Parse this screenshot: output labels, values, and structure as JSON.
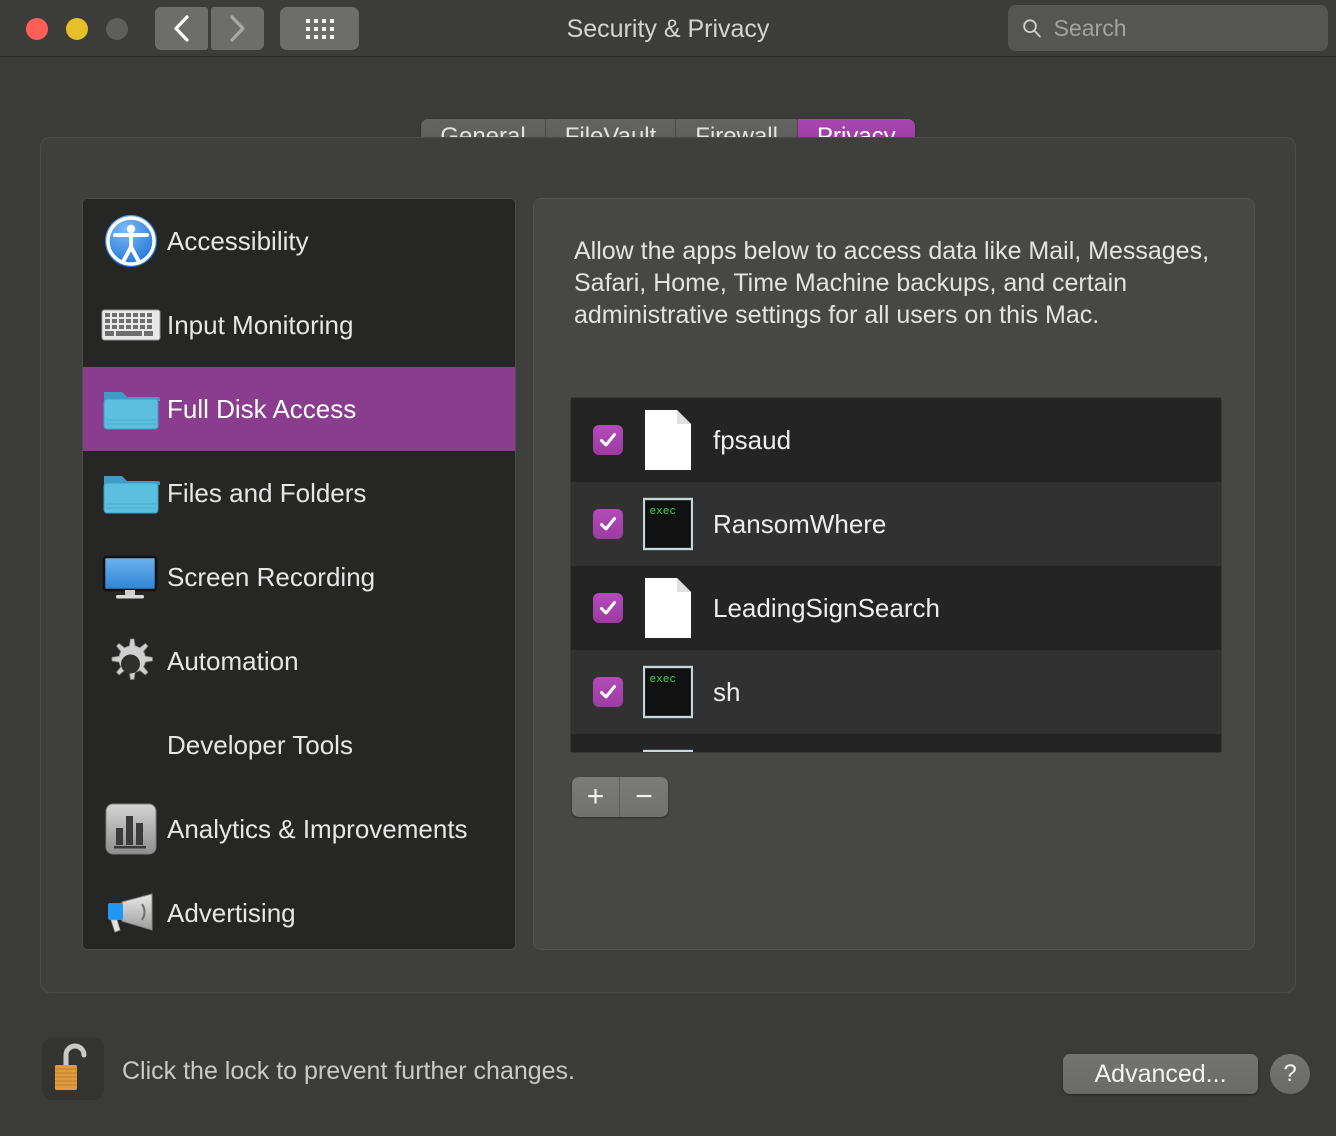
{
  "window": {
    "title": "Security & Privacy",
    "traffic_lights": [
      "close",
      "minimize",
      "zoom"
    ],
    "back_label": "Back",
    "forward_label": "Forward",
    "grid_label": "Show All"
  },
  "search": {
    "value": "",
    "placeholder": "Search"
  },
  "tabs": [
    {
      "label": "General",
      "active": false
    },
    {
      "label": "FileVault",
      "active": false
    },
    {
      "label": "Firewall",
      "active": false
    },
    {
      "label": "Privacy",
      "active": true
    }
  ],
  "sidebar": {
    "items": [
      {
        "label": "Accessibility",
        "icon": "accessibility-icon",
        "selected": false
      },
      {
        "label": "Input Monitoring",
        "icon": "keyboard-icon",
        "selected": false
      },
      {
        "label": "Full Disk Access",
        "icon": "folder-icon",
        "selected": true
      },
      {
        "label": "Files and Folders",
        "icon": "folder-icon",
        "selected": false
      },
      {
        "label": "Screen Recording",
        "icon": "display-icon",
        "selected": false
      },
      {
        "label": "Automation",
        "icon": "gear-icon",
        "selected": false
      },
      {
        "label": "Developer Tools",
        "icon": "none",
        "selected": false
      },
      {
        "label": "Analytics & Improvements",
        "icon": "bar-chart-icon",
        "selected": false
      },
      {
        "label": "Advertising",
        "icon": "megaphone-icon",
        "selected": false
      }
    ]
  },
  "pane": {
    "description": "Allow the apps below to access data like Mail, Messages, Safari, Home, Time Machine backups, and certain administrative settings for all users on this Mac.",
    "apps": [
      {
        "name": "fpsaud",
        "icon": "blank-document-icon",
        "checked": true
      },
      {
        "name": "RansomWhere",
        "icon": "exec-icon",
        "checked": true
      },
      {
        "name": "LeadingSignSearch",
        "icon": "blank-document-icon",
        "checked": true
      },
      {
        "name": "sh",
        "icon": "exec-icon",
        "checked": true
      }
    ],
    "add_label": "+",
    "remove_label": "−"
  },
  "bottom": {
    "lock_icon": "unlocked-padlock-icon",
    "lock_text": "Click the lock to prevent further changes.",
    "advanced_label": "Advanced...",
    "help_label": "?"
  },
  "colors": {
    "accent_purple": "#8a3d8f",
    "checkbox_purple": "#a93fae",
    "tab_active": "#a23fa8",
    "window_bg": "#3b3b39",
    "list_row_dark": "#242424",
    "list_row_light": "#313131"
  }
}
